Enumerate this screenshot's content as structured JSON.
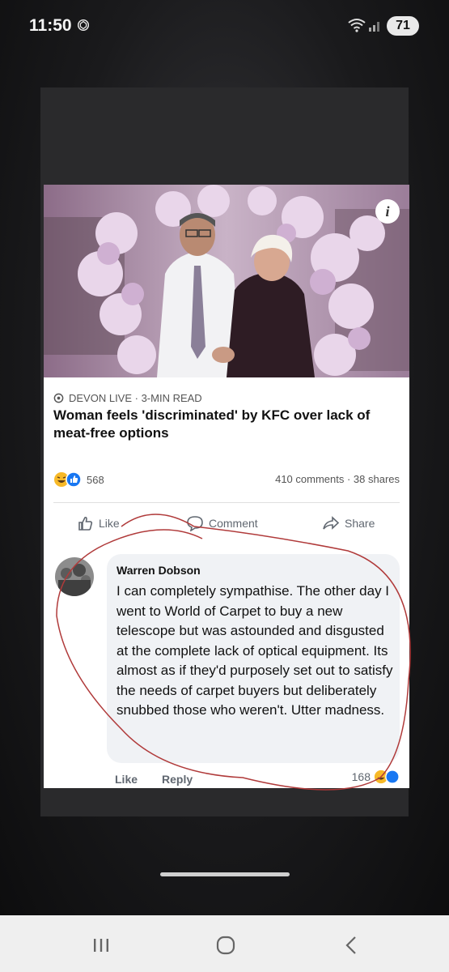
{
  "status": {
    "time": "11:50",
    "battery": "71"
  },
  "post": {
    "source": "DEVON LIVE · 3-MIN READ",
    "headline": "Woman feels 'discriminated' by KFC over lack of meat-free options",
    "reaction_count": "568",
    "comments_shares": "410 comments · 38 shares",
    "actions": {
      "like": "Like",
      "comment": "Comment",
      "share": "Share"
    }
  },
  "comment": {
    "author": "Warren Dobson",
    "text": "I can completely sympathise. The other day I went to World of Carpet to buy a new telescope but was astounded and disgusted at the complete lack of optical equipment. Its almost as if they'd purposely set out to satisfy the needs of carpet buyers but deliberately snubbed those who weren't. Utter madness.",
    "like_label": "Like",
    "reply_label": "Reply",
    "reaction_count": "168"
  },
  "colors": {
    "annotation": "#b03a3a",
    "reaction_blue": "#1877f2",
    "reaction_yellow": "#f7b928"
  },
  "icons": [
    "wifi-icon",
    "signal-icon",
    "battery-icon",
    "info-icon",
    "globe-icon",
    "haha-emoji-icon",
    "like-reaction-icon",
    "thumbs-up-icon",
    "comment-icon",
    "share-icon",
    "recents-icon",
    "home-icon",
    "back-icon"
  ]
}
